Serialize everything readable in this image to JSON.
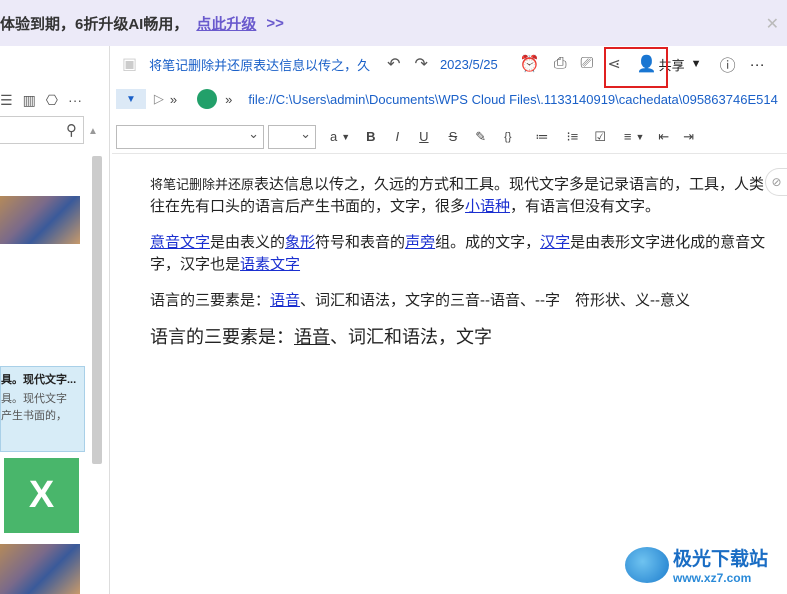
{
  "banner": {
    "text": "体验到期，6折升级AI畅用，",
    "link": "点此升级",
    "arrows": ">>",
    "close": "✕"
  },
  "sidebar": {
    "selected_card": {
      "title": "具。现代文字...",
      "line1": "具。现代文字",
      "line2": "产生书面的，"
    },
    "x_icon": "X"
  },
  "toolbar": {
    "note_title": "将笔记删除并还原表达信息以传之，久",
    "date": "2023/5/25",
    "share_label": "共享",
    "more": "···"
  },
  "url": "file://C:\\Users\\admin\\Documents\\WPS Cloud Files\\.1133140919\\cachedata\\095863746E514",
  "format": {
    "font_letter": "a",
    "bold": "B",
    "italic": "I",
    "underline": "U",
    "strike": "S",
    "code": "{}"
  },
  "content": {
    "p1": {
      "strike_part": "将笔记删除并还原",
      "rest_a": "表达信息以传之，久远的方式和工具。现代文字多是记录语言的，工具，人类往在先有口头的语言后产生书面的，文字，很多",
      "link1": "小语种",
      "rest_b": "，有语言但没有文字。"
    },
    "p2": {
      "link1": "意音文字",
      "t1": "是由表义的",
      "link2": "象形",
      "t2": "符号和表音的",
      "link3": "声旁",
      "t3": "组。成的文字，",
      "link4": "汉字",
      "t4": "是由表形文字进化成的意音文字，汉字也是",
      "link5": "语素文字"
    },
    "p3": {
      "t1": "语言的三要素是：",
      "link1": "语音",
      "t2": "、词汇和语法，文字的三音--语音、--字　符形状、义--意义"
    },
    "p4": {
      "t1": "语言的三要素是：",
      "u1": "语音",
      "t2": "、词汇和语法，文字"
    }
  },
  "watermark": {
    "title": "极光下载站",
    "url": "www.xz7.com"
  }
}
